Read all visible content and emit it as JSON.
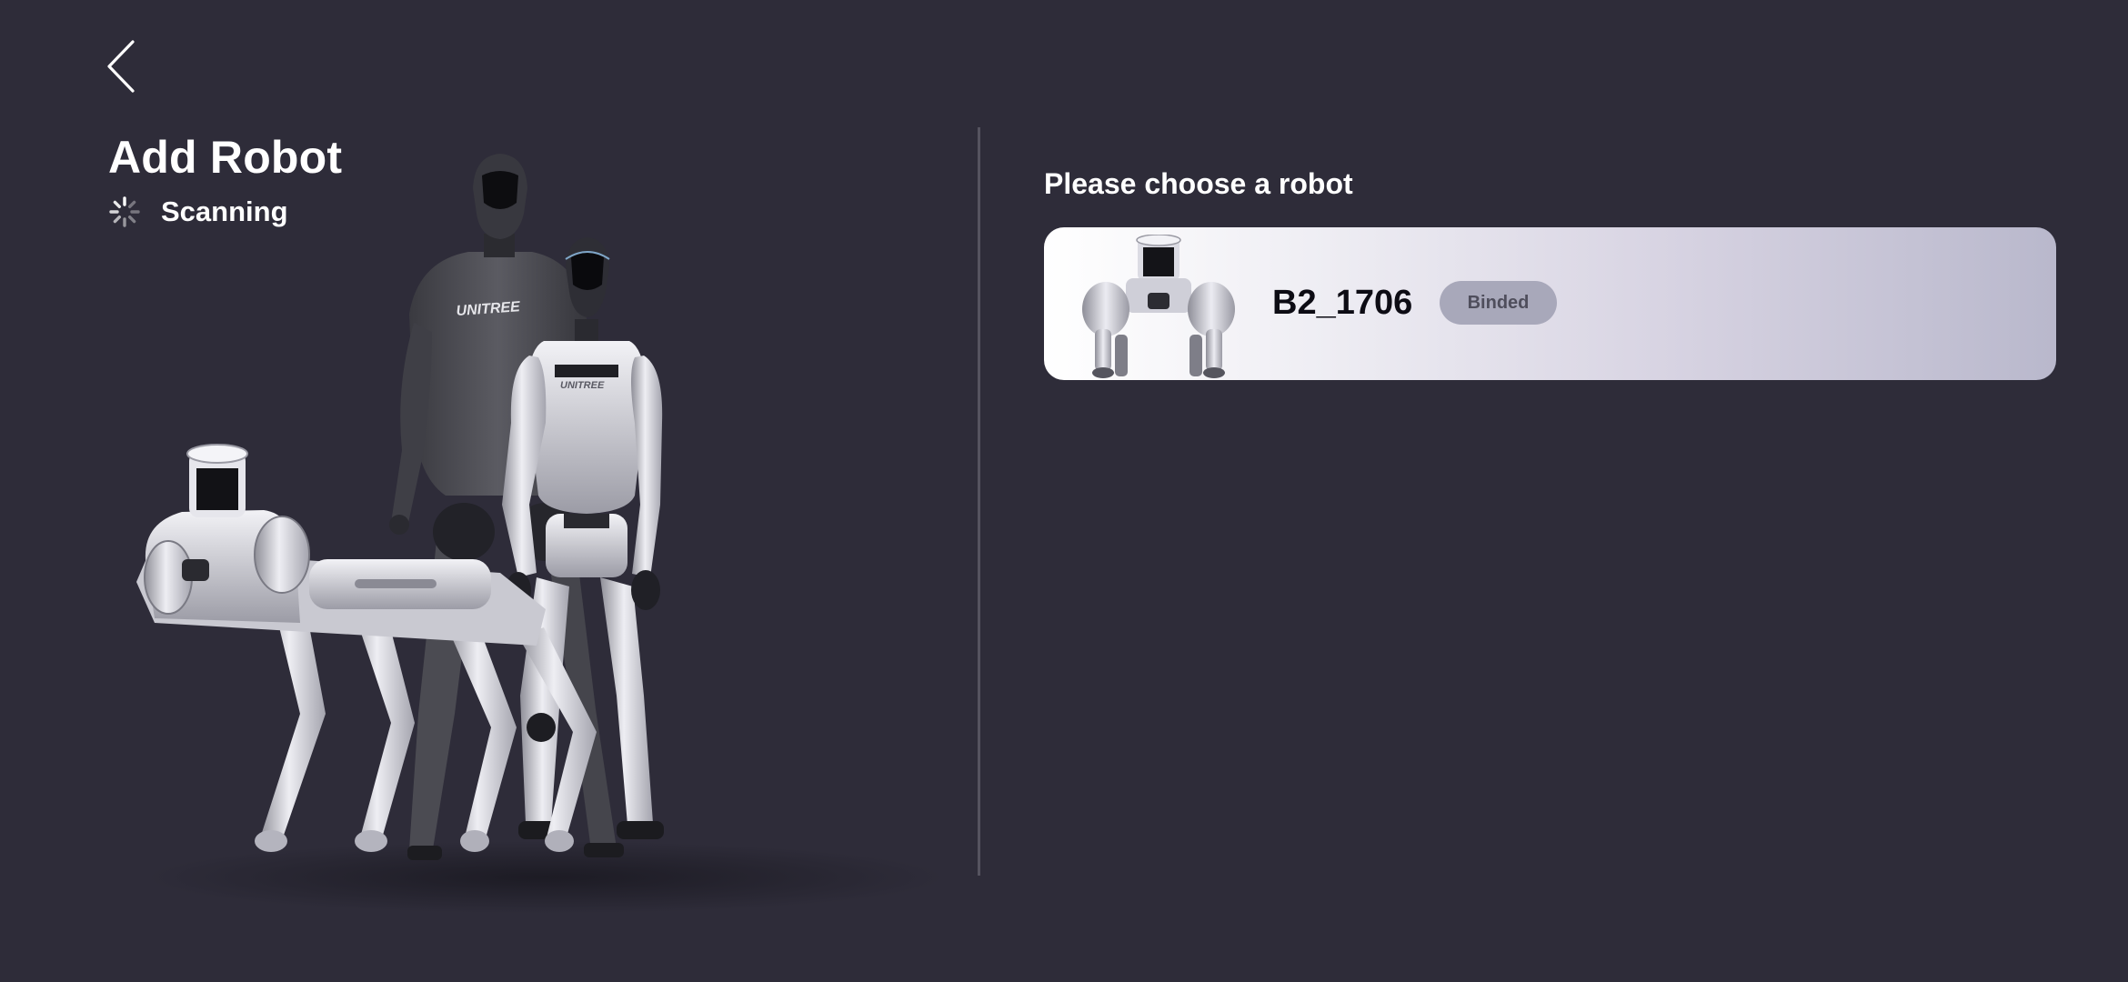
{
  "header": {
    "back_icon": "chevron-left-icon"
  },
  "left_panel": {
    "title": "Add Robot",
    "status": {
      "icon": "spinner-icon",
      "label": "Scanning"
    },
    "hero_image": {
      "brand_text": "UNITREE"
    }
  },
  "right_panel": {
    "heading": "Please choose a robot",
    "robots": [
      {
        "name": "B2_1706",
        "status": "Binded"
      }
    ]
  },
  "colors": {
    "background": "#2e2c39",
    "divider": "#55535f",
    "text_primary": "#ffffff",
    "card_gradient_start": "#ffffff",
    "card_gradient_end": "#b9b8cc",
    "badge_background": "#a8a8ba",
    "badge_text": "#4f4e5c"
  }
}
